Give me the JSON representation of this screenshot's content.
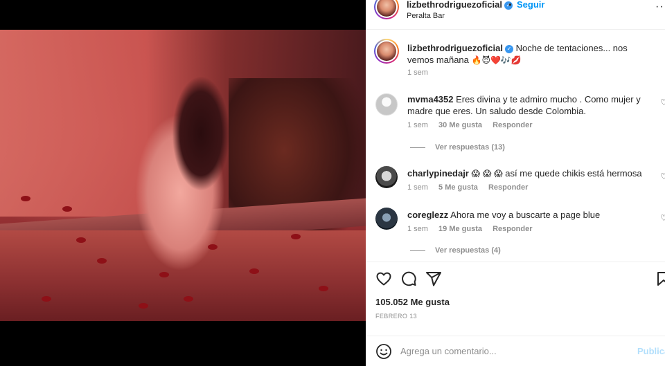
{
  "header": {
    "username": "lizbethrodriguezoficial",
    "dot": "•",
    "follow_label": "Seguir",
    "location": "Peralta Bar",
    "more_label": "···"
  },
  "caption": {
    "username": "lizbethrodriguezoficial",
    "text": "Noche de tentaciones... nos vemos mañana",
    "emojis": "🔥😈❤️🎶💋",
    "time": "1 sem"
  },
  "comments": [
    {
      "username": "mvma4352",
      "text": "Eres divina y te admiro mucho . Como mujer y madre que eres. Un saludo desde Colombia.",
      "time": "1 sem",
      "likes": "30 Me gusta",
      "reply_label": "Responder",
      "view_replies": "Ver respuestas (13)"
    },
    {
      "username": "charlypinedajr",
      "emojis": "😱 😱 😱",
      "text": "así me quede chikis está hermosa",
      "time": "1 sem",
      "likes": "5 Me gusta",
      "reply_label": "Responder"
    },
    {
      "username": "coreglezz",
      "text": "Ahora me voy a buscarte a page blue",
      "time": "1 sem",
      "likes": "19 Me gusta",
      "reply_label": "Responder",
      "view_replies": "Ver respuestas (4)"
    }
  ],
  "actions": {
    "icons": [
      "heart-icon",
      "comment-icon",
      "share-icon",
      "bookmark-icon"
    ],
    "likes_count": "105.052 Me gusta",
    "date": "FEBRERO 13"
  },
  "add_comment": {
    "placeholder": "Agrega un comentario...",
    "post_label": "Publica"
  },
  "colors": {
    "accent": "#0095f6",
    "post_disabled": "#b2dffc",
    "muted": "#8e8e8e",
    "verified": "#3897f0"
  }
}
